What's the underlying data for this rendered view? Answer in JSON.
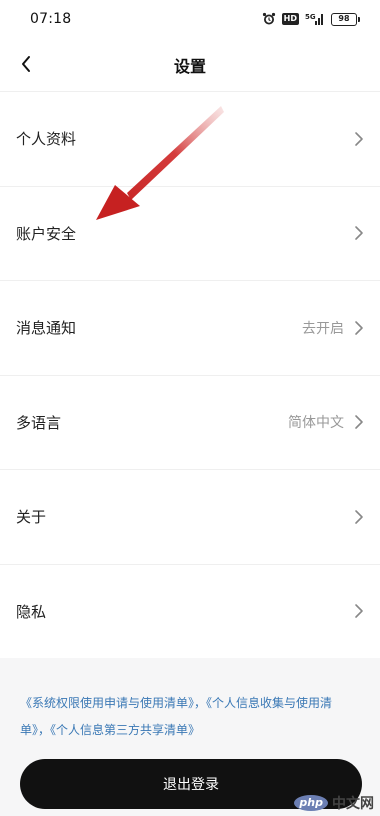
{
  "status_bar": {
    "time": "07:18",
    "icons": [
      "alarm-icon",
      "hd-icon",
      "signal-icon",
      "battery-icon"
    ],
    "hd_label": "HD",
    "signal_label": "5G",
    "battery_level": "98"
  },
  "nav": {
    "title": "设置",
    "back_icon": "chevron-left-icon"
  },
  "settings": [
    {
      "label": "个人资料",
      "value": ""
    },
    {
      "label": "账户安全",
      "value": ""
    },
    {
      "label": "消息通知",
      "value": "去开启"
    },
    {
      "label": "多语言",
      "value": "简体中文"
    },
    {
      "label": "关于",
      "value": ""
    },
    {
      "label": "隐私",
      "value": ""
    }
  ],
  "policy": {
    "link1": "《系统权限使用申请与使用清单》",
    "sep1": "，",
    "link2": "《个人信息收集与使用清单》",
    "sep2": "，",
    "link3": "《个人信息第三方共享清单》"
  },
  "logout_label": "退出登录",
  "watermark": {
    "badge": "php",
    "text": "中文网"
  },
  "colors": {
    "accent_link": "#3a78b5",
    "arrow": "#d42a2a",
    "button_bg": "#111111"
  }
}
